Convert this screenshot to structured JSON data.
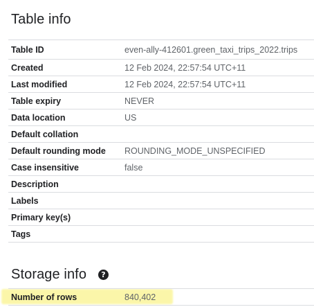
{
  "table_info": {
    "title": "Table info",
    "rows": [
      {
        "label": "Table ID",
        "value": "even-ally-412601.green_taxi_trips_2022.trips"
      },
      {
        "label": "Created",
        "value": "12 Feb 2024, 22:57:54 UTC+11"
      },
      {
        "label": "Last modified",
        "value": "12 Feb 2024, 22:57:54 UTC+11"
      },
      {
        "label": "Table expiry",
        "value": "NEVER"
      },
      {
        "label": "Data location",
        "value": "US"
      },
      {
        "label": "Default collation",
        "value": ""
      },
      {
        "label": "Default rounding mode",
        "value": "ROUNDING_MODE_UNSPECIFIED"
      },
      {
        "label": "Case insensitive",
        "value": "false"
      },
      {
        "label": "Description",
        "value": ""
      },
      {
        "label": "Labels",
        "value": ""
      },
      {
        "label": "Primary key(s)",
        "value": ""
      },
      {
        "label": "Tags",
        "value": ""
      }
    ]
  },
  "storage_info": {
    "title": "Storage info",
    "help_icon": "help-circle-icon",
    "help_glyph": "?",
    "rows": [
      {
        "label": "Number of rows",
        "value": "840,402"
      }
    ]
  },
  "colors": {
    "highlight": "#fbf59b",
    "label_text": "#202124",
    "value_text": "#5f6368",
    "divider": "#dadce0"
  }
}
